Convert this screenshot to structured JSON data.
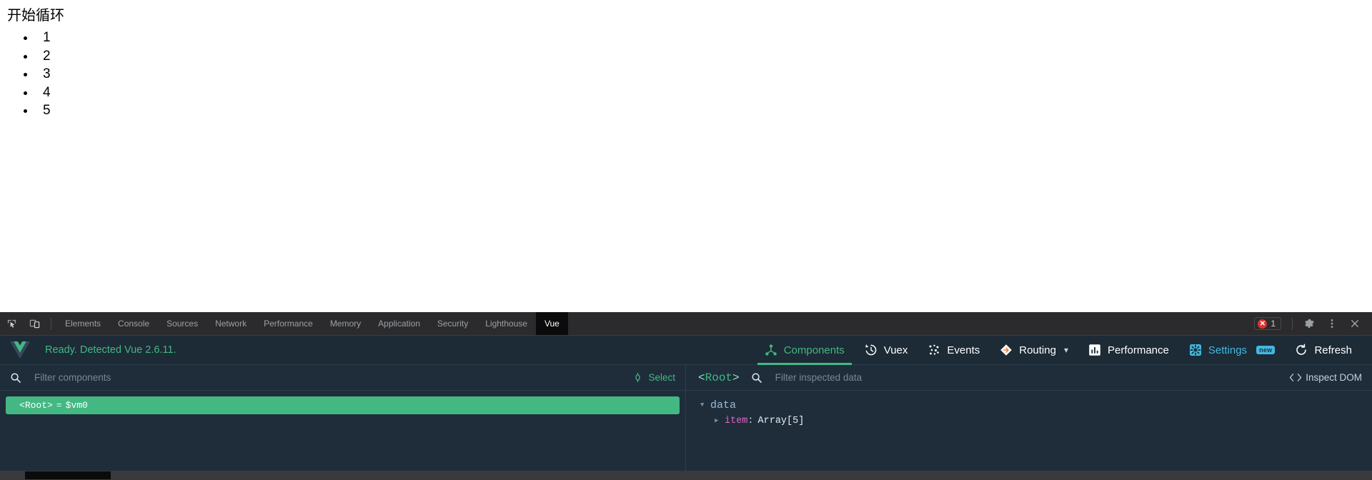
{
  "page": {
    "heading": "开始循环",
    "list_items": [
      "1",
      "2",
      "3",
      "4",
      "5"
    ]
  },
  "devtools": {
    "left_icons": [
      {
        "name": "inspect-element-icon",
        "label": "Inspect element"
      },
      {
        "name": "device-toolbar-icon",
        "label": "Toggle device toolbar"
      }
    ],
    "tabs": [
      {
        "label": "Elements",
        "active": false
      },
      {
        "label": "Console",
        "active": false
      },
      {
        "label": "Sources",
        "active": false
      },
      {
        "label": "Network",
        "active": false
      },
      {
        "label": "Performance",
        "active": false
      },
      {
        "label": "Memory",
        "active": false
      },
      {
        "label": "Application",
        "active": false
      },
      {
        "label": "Security",
        "active": false
      },
      {
        "label": "Lighthouse",
        "active": false
      },
      {
        "label": "Vue",
        "active": true
      }
    ],
    "error_badge": {
      "icon": "error-x-icon",
      "count": "1"
    },
    "right_icons": [
      {
        "name": "settings-gear-icon"
      },
      {
        "name": "more-options-kebab-icon"
      },
      {
        "name": "close-devtools-icon"
      }
    ]
  },
  "vue": {
    "logo": "vue-logo-icon",
    "status": "Ready. Detected Vue 2.6.11.",
    "status_color": "#42b883",
    "nav": [
      {
        "label": "Components",
        "icon": "components-icon",
        "active": true,
        "style": "default",
        "badge": "",
        "chevron": false
      },
      {
        "label": "Vuex",
        "icon": "vuex-clock-icon",
        "active": false,
        "style": "default",
        "badge": "",
        "chevron": false
      },
      {
        "label": "Events",
        "icon": "events-dots-icon",
        "active": false,
        "style": "default",
        "badge": "",
        "chevron": false
      },
      {
        "label": "Routing",
        "icon": "routing-diamond-icon",
        "active": false,
        "style": "default",
        "badge": "",
        "chevron": true
      },
      {
        "label": "Performance",
        "icon": "performance-bars-icon",
        "active": false,
        "style": "default",
        "badge": "",
        "chevron": false
      },
      {
        "label": "Settings",
        "icon": "settings-cog-icon",
        "active": false,
        "style": "cyan",
        "badge": "new",
        "chevron": false
      },
      {
        "label": "Refresh",
        "icon": "refresh-icon",
        "active": false,
        "style": "default",
        "badge": "",
        "chevron": false
      }
    ],
    "components_pane": {
      "search_icon": "search-icon",
      "filter_placeholder": "Filter components",
      "filter_value": "",
      "select_label": "Select",
      "select_icon": "target-crosshair-icon",
      "tree": [
        {
          "bracket_open": "<",
          "tag": "Root",
          "bracket_close": ">",
          "eq": "=",
          "vm": "$vm0",
          "selected": true
        }
      ]
    },
    "inspector_pane": {
      "root_bracket_open": "<",
      "root_tag": "Root",
      "root_bracket_close": ">",
      "search_icon": "search-icon",
      "filter_placeholder": "Filter inspected data",
      "filter_value": "",
      "inspect_dom_label": "Inspect DOM",
      "inspect_dom_icon": "code-brackets-icon",
      "tree": {
        "group_label": "data",
        "group_expanded": true,
        "rows": [
          {
            "key": "item",
            "colon": ":",
            "value": "Array[5]",
            "expanded": false
          }
        ]
      }
    }
  },
  "colors": {
    "vue_green": "#42b883",
    "settings_cyan": "#44b7e0",
    "panel_bg": "#1f2d3a",
    "header_bg": "#1c2b36",
    "tabbar_bg": "#2b2b2d",
    "error_red": "#e03131"
  }
}
